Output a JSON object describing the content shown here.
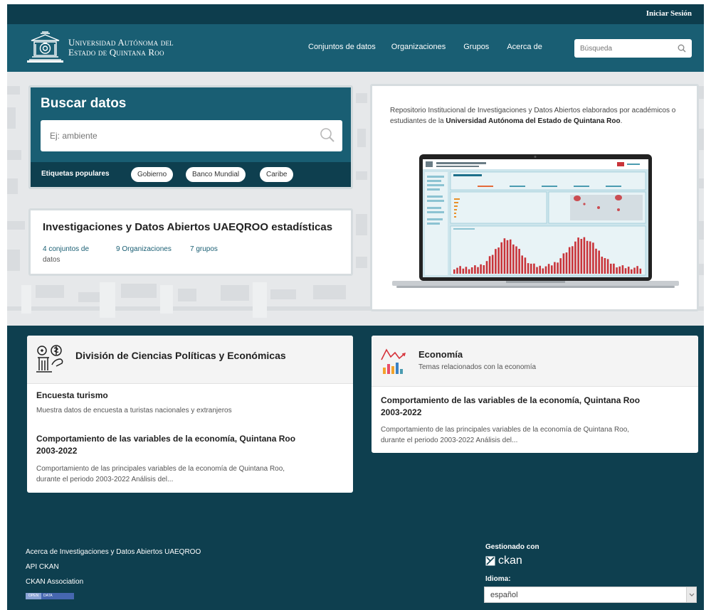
{
  "header": {
    "login_label": "Iniciar Sesión",
    "logo_line1": "Universidad Autónoma del",
    "logo_line2": "Estado de Quintana Roo",
    "nav": [
      "Conjuntos de datos",
      "Organizaciones",
      "Grupos",
      "Acerca de"
    ],
    "search_placeholder": "Búsqueda"
  },
  "hero": {
    "search_title": "Buscar datos",
    "search_placeholder": "Ej: ambiente",
    "tags_label": "Etiquetas populares",
    "tags": [
      "Gobierno",
      "Banco Mundial",
      "Caribe"
    ],
    "stats_title": "Investigaciones y Datos Abiertos UAEQROO estadísticas",
    "stats": {
      "datasets_count": "4",
      "datasets_label_1": "conjuntos de",
      "datasets_label_2": "datos",
      "orgs_count": "9",
      "orgs_label": "Organizaciones",
      "groups_count": "7",
      "groups_label": "grupos"
    },
    "intro_text_1": "Repositorio Institucional de Investigaciones y Datos Abiertos elaborados por académicos o estudiantes de la ",
    "intro_text_bold": "Universidad Autónoma del Estado de Quintana Roo",
    "intro_text_2": "."
  },
  "showcase": {
    "group": {
      "title": "División de Ciencias Políticas y Económicas",
      "datasets": [
        {
          "title": "Encuesta turismo",
          "desc": "Muestra datos de encuesta a turistas nacionales y extranjeros"
        },
        {
          "title_1": "Comportamiento de las variables de la economía, Quintana Roo",
          "title_2": "2003-2022",
          "desc_1": "Comportamiento de las principales variables de la economía de Quintana Roo,",
          "desc_2": "durante el periodo 2003-2022 Análisis del..."
        }
      ]
    },
    "topic": {
      "title": "Economía",
      "subtitle": "Temas relacionados con la economía",
      "dataset": {
        "title_1": "Comportamiento de las variables de la economía, Quintana Roo",
        "title_2": "2003-2022",
        "desc_1": "Comportamiento de las principales variables de la economía de Quintana Roo,",
        "desc_2": "durante el periodo 2003-2022 Análisis del..."
      }
    }
  },
  "footer": {
    "links": [
      "Acerca de Investigaciones y Datos Abiertos UAEQROO",
      "API CKAN",
      "CKAN Association"
    ],
    "badge_left": "OPEN",
    "badge_right": "DATA",
    "managed_by": "Gestionado con",
    "ckan_text": "ckan",
    "language_label": "Idioma:",
    "language_value": "español"
  },
  "colors": {
    "header_dark": "#0d3d4d",
    "header_teal": "#195e73",
    "band": "#0e3f4f",
    "chart_red": "#c9343a"
  },
  "icons": [
    "search-icon",
    "university-emblem-icon",
    "laptop-dashboard-image",
    "politics-economics-icon",
    "economy-chart-icon",
    "ckan-box-icon",
    "chevron-down-icon"
  ]
}
